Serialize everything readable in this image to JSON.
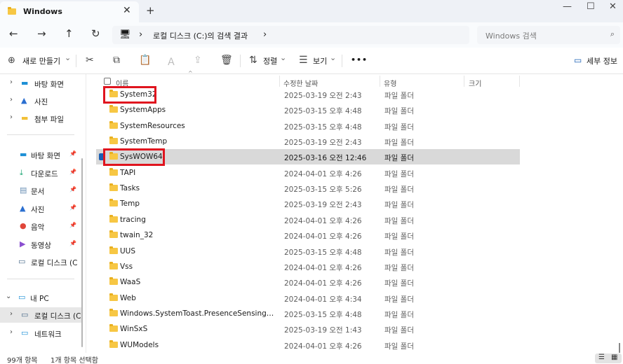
{
  "tab": {
    "title": "Windows",
    "close_glyph": "✕",
    "new_glyph": "+",
    "icon": "folder-icon"
  },
  "window_controls": {
    "minimize": "—",
    "maximize": "☐",
    "close": "✕"
  },
  "nav_buttons": {
    "back": "←",
    "forward": "→",
    "up": "↑",
    "refresh": "↻"
  },
  "address": {
    "path": "로컬 디스크 (C:)의 검색 결과",
    "chevron": "›",
    "pc_icon": "monitor-icon"
  },
  "search": {
    "placeholder": "Windows 검색",
    "icon": "⌕"
  },
  "toolbar": {
    "new_label": "새로 만들기",
    "new_plus": "⊕",
    "new_chevron": "⌄",
    "sort_label": "정렬",
    "sort_chevron": "⌄",
    "view_label": "보기",
    "view_chevron": "⌄",
    "more": "•••",
    "details_label": "세부 정보",
    "icons": {
      "cut": "✂",
      "copy": "⧉",
      "paste": "📋",
      "rename": "Ａ",
      "share": "⇪",
      "delete": "🗑",
      "sort": "⇅",
      "view": "☰",
      "details": "▭"
    }
  },
  "nav": {
    "groups1": [
      {
        "label": "바탕 화면",
        "icon": "▬",
        "icon_color": "#1e90d6"
      },
      {
        "label": "사진",
        "icon": "▲",
        "icon_color": "#2b6fd0"
      },
      {
        "label": "첨부 파일",
        "icon": "▬",
        "icon_color": "#f2c037"
      }
    ],
    "pinned": [
      {
        "label": "바탕 화면",
        "icon": "▬",
        "icon_color": "#1e90d6"
      },
      {
        "label": "다운로드",
        "icon": "⤓",
        "icon_color": "#13a36f"
      },
      {
        "label": "문서",
        "icon": "▤",
        "icon_color": "#6a8fb5"
      },
      {
        "label": "사진",
        "icon": "▲",
        "icon_color": "#2b6fd0"
      },
      {
        "label": "음악",
        "icon": "●",
        "icon_color": "#e0463a"
      },
      {
        "label": "동영상",
        "icon": "▶",
        "icon_color": "#8a4fd0"
      },
      {
        "label": "로컬 디스크 (C:)",
        "icon": "▭",
        "icon_color": "#4a6b8a"
      }
    ],
    "pin_glyph": "📌",
    "pc": {
      "label": "내 PC",
      "icon": "▭",
      "icon_color": "#1e90d6"
    },
    "pc_children": [
      {
        "label": "로컬 디스크 (C:)",
        "icon": "▭",
        "icon_color": "#4a6b8a"
      }
    ],
    "network": {
      "label": "네트워크",
      "icon": "▭",
      "icon_color": "#1e90d6"
    },
    "expand_glyph": "›",
    "collapse_glyph": "⌄"
  },
  "columns": {
    "name": "이름",
    "modified": "수정한 날짜",
    "type": "유형",
    "size": "크기",
    "sort_glyph": "^"
  },
  "files": [
    {
      "name": "System32",
      "date": "2025-03-19 오전 2:43",
      "type": "파일 폴더"
    },
    {
      "name": "SystemApps",
      "date": "2025-03-15 오후 4:48",
      "type": "파일 폴더"
    },
    {
      "name": "SystemResources",
      "date": "2025-03-15 오후 4:48",
      "type": "파일 폴더"
    },
    {
      "name": "SystemTemp",
      "date": "2025-03-19 오전 2:43",
      "type": "파일 폴더"
    },
    {
      "name": "SysWOW64",
      "date": "2025-03-16 오전 12:46",
      "type": "파일 폴더"
    },
    {
      "name": "TAPI",
      "date": "2024-04-01 오후 4:26",
      "type": "파일 폴더"
    },
    {
      "name": "Tasks",
      "date": "2025-03-15 오후 5:26",
      "type": "파일 폴더"
    },
    {
      "name": "Temp",
      "date": "2025-03-19 오전 2:43",
      "type": "파일 폴더"
    },
    {
      "name": "tracing",
      "date": "2024-04-01 오후 4:26",
      "type": "파일 폴더"
    },
    {
      "name": "twain_32",
      "date": "2024-04-01 오후 4:26",
      "type": "파일 폴더"
    },
    {
      "name": "UUS",
      "date": "2025-03-15 오후 4:48",
      "type": "파일 폴더"
    },
    {
      "name": "Vss",
      "date": "2024-04-01 오후 4:26",
      "type": "파일 폴더"
    },
    {
      "name": "WaaS",
      "date": "2024-04-01 오후 4:26",
      "type": "파일 폴더"
    },
    {
      "name": "Web",
      "date": "2024-04-01 오후 4:34",
      "type": "파일 폴더"
    },
    {
      "name": "Windows.SystemToast.PresenceSensing.Onlooker...",
      "date": "2025-03-15 오후 4:48",
      "type": "파일 폴더"
    },
    {
      "name": "WinSxS",
      "date": "2025-03-19 오전 1:43",
      "type": "파일 폴더"
    },
    {
      "name": "WUModels",
      "date": "2024-04-01 오후 4:26",
      "type": "파일 폴더"
    }
  ],
  "selected_file": "SysWOW64",
  "highlighted_files": [
    "System32",
    "SysWOW64"
  ],
  "highlight_color": "#e0141e",
  "status": {
    "count": "99개 항목",
    "selection": "1개 항목 선택함",
    "view_list": "☰",
    "view_tiles": "▦"
  }
}
